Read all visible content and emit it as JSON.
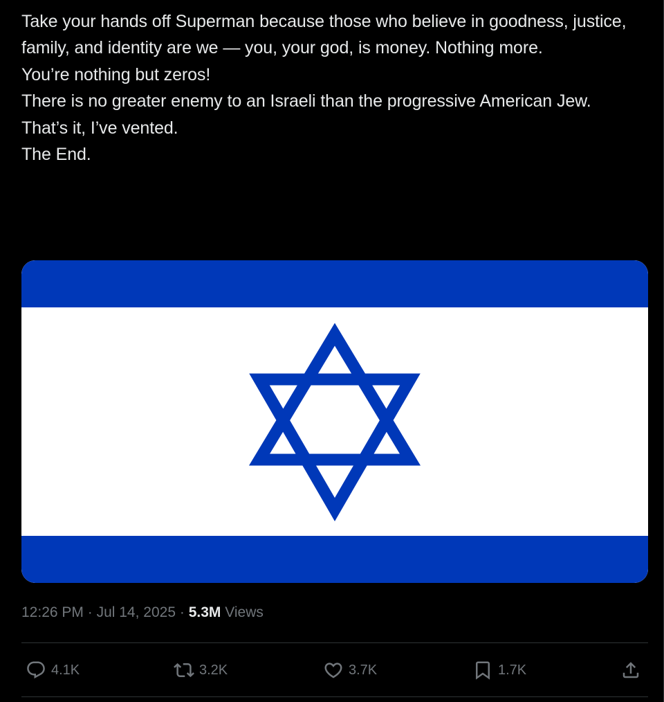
{
  "tweet": {
    "lines": [
      "Take your hands off Superman because those who believe in goodness, justice, family, and identity are we — you, your god, is money. Nothing more.",
      "You’re nothing but zeros!",
      "There is no greater enemy to an Israeli than the progressive American Jew.",
      "",
      "That’s it, I’ve vented.",
      "The End."
    ]
  },
  "media": {
    "description_icon": "israel-flag-image",
    "colors": {
      "stripe": "#0038b8",
      "field": "#ffffff"
    }
  },
  "meta": {
    "time": "12:26 PM",
    "separator": "·",
    "date": "Jul 14, 2025",
    "views_count": "5.3M",
    "views_label": "Views"
  },
  "actions": {
    "reply": {
      "icon": "reply-icon",
      "count": "4.1K"
    },
    "retweet": {
      "icon": "retweet-icon",
      "count": "3.2K"
    },
    "like": {
      "icon": "heart-icon",
      "count": "3.7K"
    },
    "bookmark": {
      "icon": "bookmark-icon",
      "count": "1.7K"
    },
    "share": {
      "icon": "share-icon"
    }
  },
  "colors": {
    "background": "#000000",
    "text": "#e7e9ea",
    "muted": "#71767b",
    "divider": "#2f3336"
  }
}
